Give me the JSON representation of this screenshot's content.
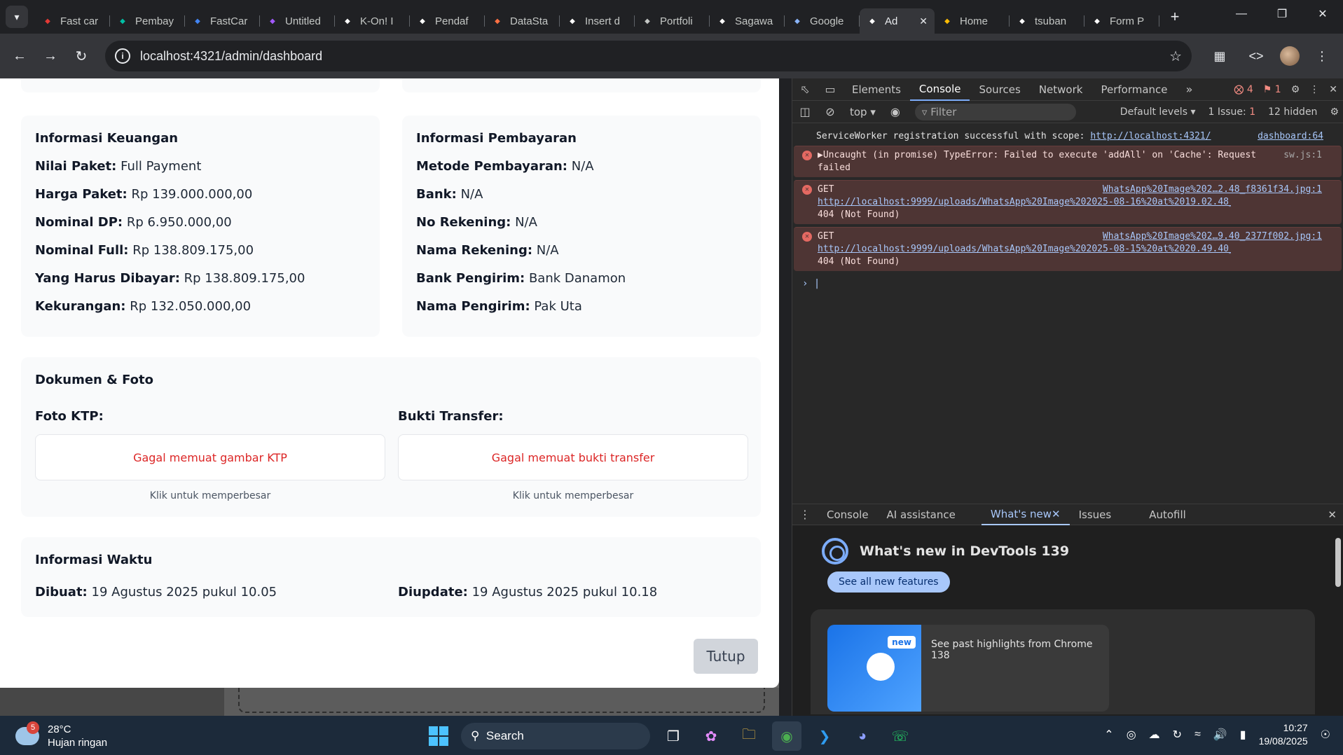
{
  "browser": {
    "tabs": [
      {
        "title": "Fast car",
        "icon": "red-slash",
        "color": "#e53935"
      },
      {
        "title": "Pembay",
        "icon": "c-logo",
        "color": "#00bfa5"
      },
      {
        "title": "FastCar",
        "icon": "blue-doc",
        "color": "#4285f4"
      },
      {
        "title": "Untitled",
        "icon": "figma",
        "color": "#a259ff"
      },
      {
        "title": "K-On! I",
        "icon": "notion",
        "color": "#ffffff"
      },
      {
        "title": "Pendaf",
        "icon": "lambda",
        "color": "#ffffff"
      },
      {
        "title": "DataSta",
        "icon": "chevron-a",
        "color": "#ff7043"
      },
      {
        "title": "Insert d",
        "icon": "ds",
        "color": "#ffffff"
      },
      {
        "title": "Portfoli",
        "icon": "globe",
        "color": "#c4c7c5"
      },
      {
        "title": "Sagawa",
        "icon": "astro",
        "color": "#ffffff"
      },
      {
        "title": "Google",
        "icon": "gemini",
        "color": "#8ab4f8"
      },
      {
        "title": "Ad",
        "icon": "astro",
        "color": "#ffffff",
        "active": true
      },
      {
        "title": "Home",
        "icon": "drive",
        "color": "#fbbc04"
      },
      {
        "title": "tsuban",
        "icon": "github",
        "color": "#ffffff"
      },
      {
        "title": "Form P",
        "icon": "astro",
        "color": "#ffffff"
      }
    ],
    "url": "localhost:4321/admin/dashboard"
  },
  "modal": {
    "keuangan": {
      "title": "Informasi Keuangan",
      "fields": [
        {
          "label": "Nilai Paket:",
          "value": "Full Payment"
        },
        {
          "label": "Harga Paket:",
          "value": "Rp 139.000.000,00"
        },
        {
          "label": "Nominal DP:",
          "value": "Rp 6.950.000,00"
        },
        {
          "label": "Nominal Full:",
          "value": "Rp 138.809.175,00"
        },
        {
          "label": "Yang Harus Dibayar:",
          "value": "Rp 138.809.175,00"
        },
        {
          "label": "Kekurangan:",
          "value": "Rp 132.050.000,00"
        }
      ]
    },
    "pembayaran": {
      "title": "Informasi Pembayaran",
      "fields": [
        {
          "label": "Metode Pembayaran:",
          "value": "N/A"
        },
        {
          "label": "Bank:",
          "value": "N/A"
        },
        {
          "label": "No Rekening:",
          "value": "N/A"
        },
        {
          "label": "Nama Rekening:",
          "value": "N/A"
        },
        {
          "label": "Bank Pengirim:",
          "value": "Bank Danamon"
        },
        {
          "label": "Nama Pengirim:",
          "value": "Pak Uta"
        }
      ]
    },
    "dokumen": {
      "title": "Dokumen & Foto",
      "ktp_label": "Foto KTP:",
      "ktp_error": "Gagal memuat gambar KTP",
      "transfer_label": "Bukti Transfer:",
      "transfer_error": "Gagal memuat bukti transfer",
      "hint": "Klik untuk memperbesar"
    },
    "waktu": {
      "title": "Informasi Waktu",
      "dibuat_label": "Dibuat:",
      "dibuat_value": "19 Agustus 2025 pukul 10.05",
      "diupdate_label": "Diupdate:",
      "diupdate_value": "19 Agustus 2025 pukul 10.18"
    },
    "close_label": "Tutup"
  },
  "devtools": {
    "tabs": [
      "Elements",
      "Console",
      "Sources",
      "Network",
      "Performance"
    ],
    "active_tab": "Console",
    "error_count": "4",
    "issue_count": "1",
    "context": "top",
    "filter_placeholder": "Filter",
    "levels": "Default levels",
    "issues_label": "1 Issue:",
    "issues_count": "1",
    "hidden": "12 hidden",
    "messages": [
      {
        "type": "info",
        "text": "ServiceWorker registration successful with scope:",
        "link": "http://localhost:4321/",
        "source": "dashboard:64"
      },
      {
        "type": "error",
        "text": "▶Uncaught (in promise) TypeError: Failed to execute 'addAll' on 'Cache': Request failed",
        "source": "sw.js:1"
      },
      {
        "type": "error",
        "text": "GET",
        "link": "http://localhost:9999/uploads/WhatsApp%20Image%202025-08-16%20at%2019.02.48_f8361f34.j…",
        "status": "404 (Not Found)",
        "source": "WhatsApp%20Image%202…2.48_f8361f34.jpg:1"
      },
      {
        "type": "error",
        "text": "GET",
        "link": "http://localhost:9999/uploads/WhatsApp%20Image%202025-08-15%20at%2020.49.40_2377f002.j…",
        "status": "404 (Not Found)",
        "source": "WhatsApp%20Image%202…9.40_2377f002.jpg:1"
      }
    ],
    "drawer": {
      "tabs": [
        "Console",
        "AI assistance",
        "What's new",
        "Issues",
        "Autofill"
      ],
      "active_tab": "What's new",
      "title": "What's new in DevTools 139",
      "see_all": "See all new features",
      "new_badge": "new",
      "highlight": "See past highlights from Chrome 138"
    }
  },
  "taskbar": {
    "weather_badge": "5",
    "temperature": "28°C",
    "condition": "Hujan ringan",
    "search": "Search",
    "time": "10:27",
    "date": "19/08/2025"
  }
}
